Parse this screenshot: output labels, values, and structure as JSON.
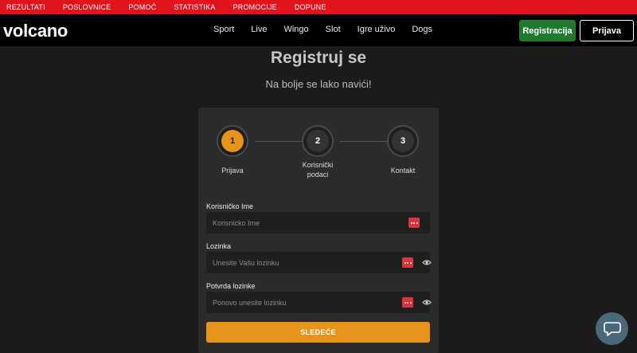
{
  "topbar": {
    "links": [
      "REZULTATI",
      "POSLOVNICE",
      "POMOĆ",
      "STATISTIKA",
      "PROMOCIJE",
      "DOPUNE"
    ]
  },
  "header": {
    "logo": "volcano",
    "nav": [
      "Sport",
      "Live",
      "Wingo",
      "Slot",
      "Igre uživo",
      "Dogs"
    ],
    "register_label": "Registracija",
    "login_label": "Prijava"
  },
  "page": {
    "title": "Registruj se",
    "subtitle": "Na bolje se lako navići!"
  },
  "steps": [
    {
      "number": "1",
      "label": "Prijava"
    },
    {
      "number": "2",
      "label": "Korisnički podaci"
    },
    {
      "number": "3",
      "label": "Kontakt"
    }
  ],
  "form": {
    "username": {
      "label": "Korisničko Ime",
      "placeholder": "Korisnicko Ime",
      "value": ""
    },
    "password": {
      "label": "Lozinka",
      "placeholder": "Unesite Vašu lozinku",
      "value": ""
    },
    "password_confirm": {
      "label": "Potvrda lozinke",
      "placeholder": "Ponovo unesite lozinku",
      "value": ""
    },
    "next_label": "SLEDEĆE"
  },
  "icons": {
    "password_manager": "password-manager-icon",
    "toggle_visibility": "eye-icon",
    "chat": "chat-icon"
  },
  "colors": {
    "topbar": "#e1141e",
    "accent": "#e8941a",
    "register": "#1f7a2e",
    "card": "#2b2b2b"
  }
}
